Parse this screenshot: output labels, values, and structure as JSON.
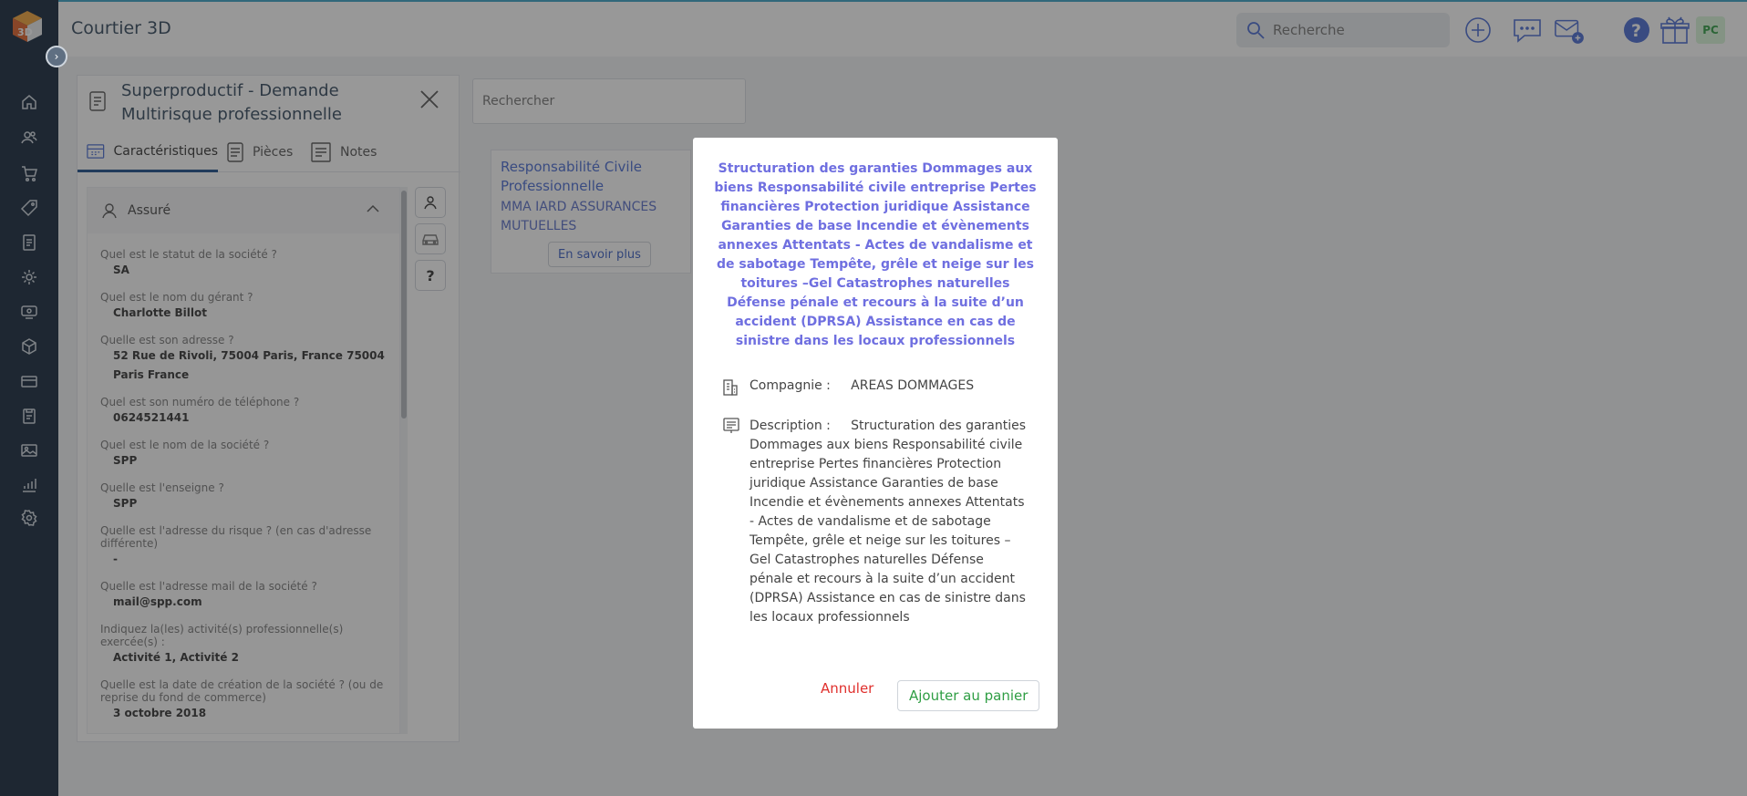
{
  "app": {
    "title": "Courtier 3D"
  },
  "header": {
    "search_placeholder": "Recherche",
    "avatar_initials": "PC"
  },
  "sidebar": {
    "items": [
      {
        "icon": "home-icon"
      },
      {
        "icon": "users-icon"
      },
      {
        "icon": "cart-icon"
      },
      {
        "icon": "tag-icon"
      },
      {
        "icon": "contract-icon"
      },
      {
        "icon": "gear-icon"
      },
      {
        "icon": "claims-icon"
      },
      {
        "icon": "package-icon"
      },
      {
        "icon": "card-icon"
      },
      {
        "icon": "reports-icon"
      },
      {
        "icon": "images-icon"
      },
      {
        "icon": "stats-icon"
      },
      {
        "icon": "settings-icon"
      }
    ]
  },
  "panel": {
    "title": "Superproductif - Demande Multirisque professionnelle",
    "tabs": [
      {
        "label": "Caractéristiques"
      },
      {
        "label": "Pièces"
      },
      {
        "label": "Notes"
      }
    ],
    "section_title": "Assuré",
    "qa": [
      {
        "q": "Quel est le statut de la société ?",
        "a": "SA"
      },
      {
        "q": "Quel est le nom du gérant ?",
        "a": "Charlotte Billot"
      },
      {
        "q": "Quelle est son adresse ?",
        "a": "52 Rue de Rivoli, 75004 Paris, France 75004 Paris France"
      },
      {
        "q": "Quel est son numéro de téléphone ?",
        "a": "0624521441"
      },
      {
        "q": "Quel est le nom de la société ?",
        "a": "SPP"
      },
      {
        "q": "Quelle est l'enseigne ?",
        "a": "SPP"
      },
      {
        "q": "Quelle est l'adresse du risque ? (en cas d'adresse différente)",
        "a": "-"
      },
      {
        "q": "Quelle est l'adresse mail de la société ?",
        "a": "mail@spp.com"
      },
      {
        "q": "Indiquez la(les) activité(s) professionnelle(s) exercée(s) :",
        "a": "Activité 1, Activité 2"
      },
      {
        "q": "Quelle est la date de création de la société ? (ou de reprise du fond de commerce)",
        "a": "3 octobre 2018"
      }
    ]
  },
  "main": {
    "filter_placeholder": "Rechercher",
    "card": {
      "title": "Responsabilité Civile Professionnelle",
      "insurer": "MMA IARD ASSURANCES MUTUELLES",
      "button": "En savoir plus"
    }
  },
  "modal": {
    "title": "Structuration des garanties Dommages aux biens Responsabilité civile entreprise Pertes financières Protection juridique Assistance Garanties de base Incendie et évènements annexes Attentats - Actes de vandalisme et de sabotage Tempête, grêle et neige sur les toitures –Gel Catastrophes naturelles Défense pénale et recours à la suite d’un accident (DPRSA) Assistance en cas de sinistre dans les locaux professionnels",
    "company_label": "Compagnie :",
    "company_value": "AREAS DOMMAGES",
    "description_label": "Description :",
    "description_value": "Structuration des garanties Dommages aux biens Responsabilité civile entreprise Pertes financières Protection juridique Assistance Garanties de base Incendie et évènements annexes Attentats - Actes de vandalisme et de sabotage Tempête, grêle et neige sur les toitures –Gel Catastrophes naturelles Défense pénale et recours à la suite d’un accident (DPRSA) Assistance en cas de sinistre dans les locaux professionnels",
    "cancel": "Annuler",
    "add": "Ajouter au panier"
  },
  "colors": {
    "sidebar": "#16283d",
    "modal_title": "#6f6fe0",
    "cancel": "#e0302d",
    "add": "#2f9e44",
    "link": "#4a6cd4"
  }
}
